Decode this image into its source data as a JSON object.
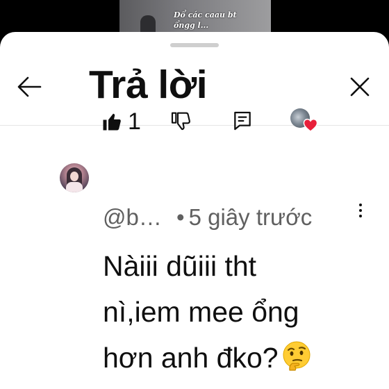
{
  "video": {
    "caption_line1": "Dổ các caau bt",
    "caption_line2": "ổngg l..."
  },
  "sheet": {
    "title": "Trả lời",
    "back_icon": "arrow-left-icon",
    "close_icon": "close-icon"
  },
  "actions": {
    "like_count": "1",
    "like_icon": "thumbs-up-filled-icon",
    "dislike_icon": "thumbs-down-icon",
    "reply_icon": "reply-comment-icon",
    "creator_heart_icon": "creator-heart-icon",
    "heart_color": "#e8203a"
  },
  "comment": {
    "author": "@b…",
    "time": "5 giây trước",
    "text_line1": "Nàiii dũiii tht",
    "text_line2": "nì,iem mee ổng",
    "text_line3": "hơn anh đko?",
    "emoji": "thinking-face-emoji",
    "more_icon": "more-vertical-icon"
  }
}
